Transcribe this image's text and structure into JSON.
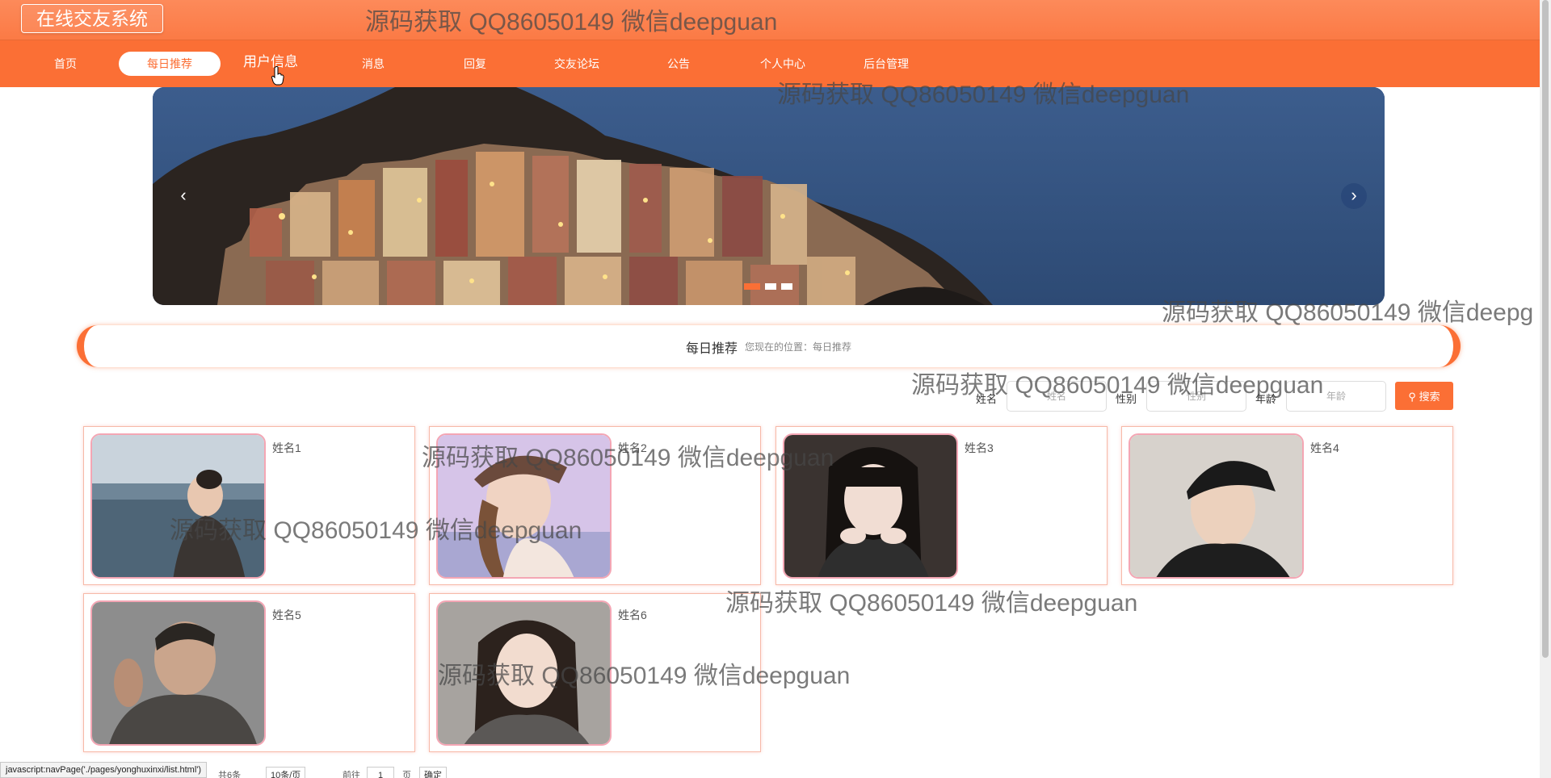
{
  "app": {
    "brand": "在线交友系统"
  },
  "nav": {
    "items": [
      {
        "label": "首页"
      },
      {
        "label": "每日推荐"
      },
      {
        "label": "用户信息"
      },
      {
        "label": "消息"
      },
      {
        "label": "回复"
      },
      {
        "label": "交友论坛"
      },
      {
        "label": "公告"
      },
      {
        "label": "个人中心"
      },
      {
        "label": "后台管理"
      }
    ],
    "active_index": 1,
    "hovered_index": 2
  },
  "banner": {
    "prev_icon": "chevron-left-icon",
    "next_icon": "chevron-right-icon",
    "slide_count": 3,
    "active_slide": 1
  },
  "breadcrumb": {
    "title": "每日推荐",
    "path": "您现在的位置：每日推荐"
  },
  "search": {
    "name_label": "姓名",
    "name_placeholder": "姓名",
    "gender_label": "性别",
    "gender_placeholder": "性别",
    "age_label": "年龄",
    "age_placeholder": "年龄",
    "button_label": "搜索",
    "button_icon": "search-icon"
  },
  "cards": [
    {
      "name": "姓名1"
    },
    {
      "name": "姓名2"
    },
    {
      "name": "姓名3"
    },
    {
      "name": "姓名4"
    },
    {
      "name": "姓名5"
    },
    {
      "name": "姓名6"
    }
  ],
  "pager": {
    "total": "共6条",
    "page_size": "10条/页",
    "goto_prefix": "前往",
    "goto_value": "1",
    "goto_suffix": "页",
    "confirm": "确定"
  },
  "status_bar": "javascript:navPage('./pages/yonghuxinxi/list.html')",
  "watermark": "源码获取 QQ86050149 微信deepguan",
  "watermark_cut": "源码获取 QQ86050149 微信deepg",
  "colors": {
    "primary": "#fb6f35",
    "card_border": "#f7b9a8",
    "photo_border": "#f4a6b4"
  }
}
